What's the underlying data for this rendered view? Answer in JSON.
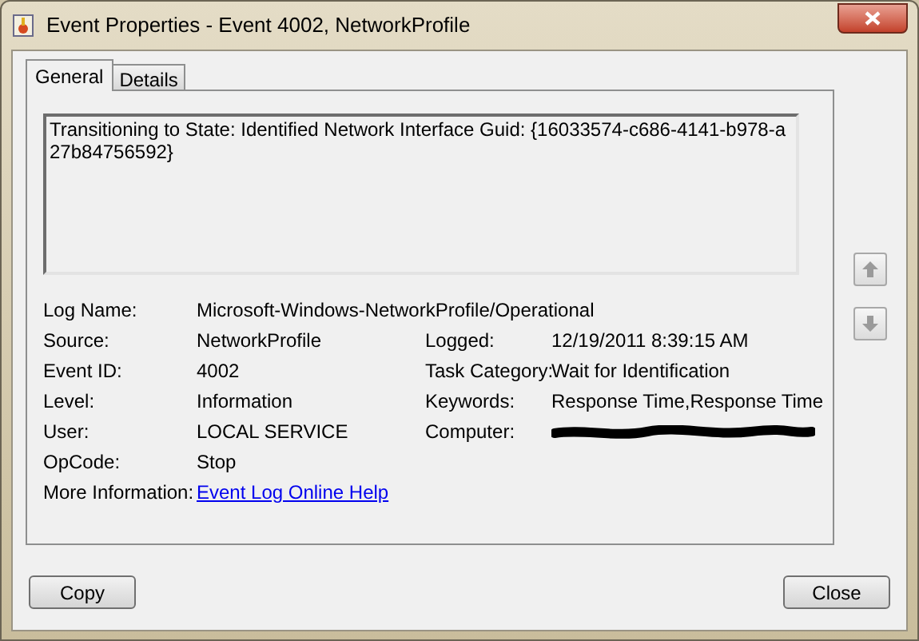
{
  "window": {
    "title": "Event Properties - Event 4002, NetworkProfile"
  },
  "tabs": [
    {
      "label": "General",
      "selected": true
    },
    {
      "label": "Details",
      "selected": false
    }
  ],
  "description": "Transitioning to State: Identified Network Interface Guid: {16033574-c686-4141-b978-a27b84756592}",
  "fields_left": [
    {
      "label": "Log Name:",
      "value": "Microsoft-Windows-NetworkProfile/Operational",
      "kind": "wide"
    },
    {
      "label": "Source:",
      "value": "NetworkProfile",
      "kind": "text"
    },
    {
      "label": "Event ID:",
      "value": "4002",
      "kind": "text"
    },
    {
      "label": "Level:",
      "value": "Information",
      "kind": "text"
    },
    {
      "label": "User:",
      "value": "LOCAL SERVICE",
      "kind": "text"
    },
    {
      "label": "OpCode:",
      "value": "Stop",
      "kind": "text"
    },
    {
      "label": "More Information:",
      "value": "Event Log Online Help",
      "kind": "link"
    }
  ],
  "fields_right": [
    {
      "label": "Logged:",
      "value": "12/19/2011 8:39:15 AM",
      "kind": "text"
    },
    {
      "label": "Task Category:",
      "value": "Wait for Identification",
      "kind": "text"
    },
    {
      "label": "Keywords:",
      "value": "Response Time,Response Time",
      "kind": "text"
    },
    {
      "label": "Computer:",
      "kind": "redacted"
    }
  ],
  "buttons": [
    "Copy",
    "Close"
  ]
}
